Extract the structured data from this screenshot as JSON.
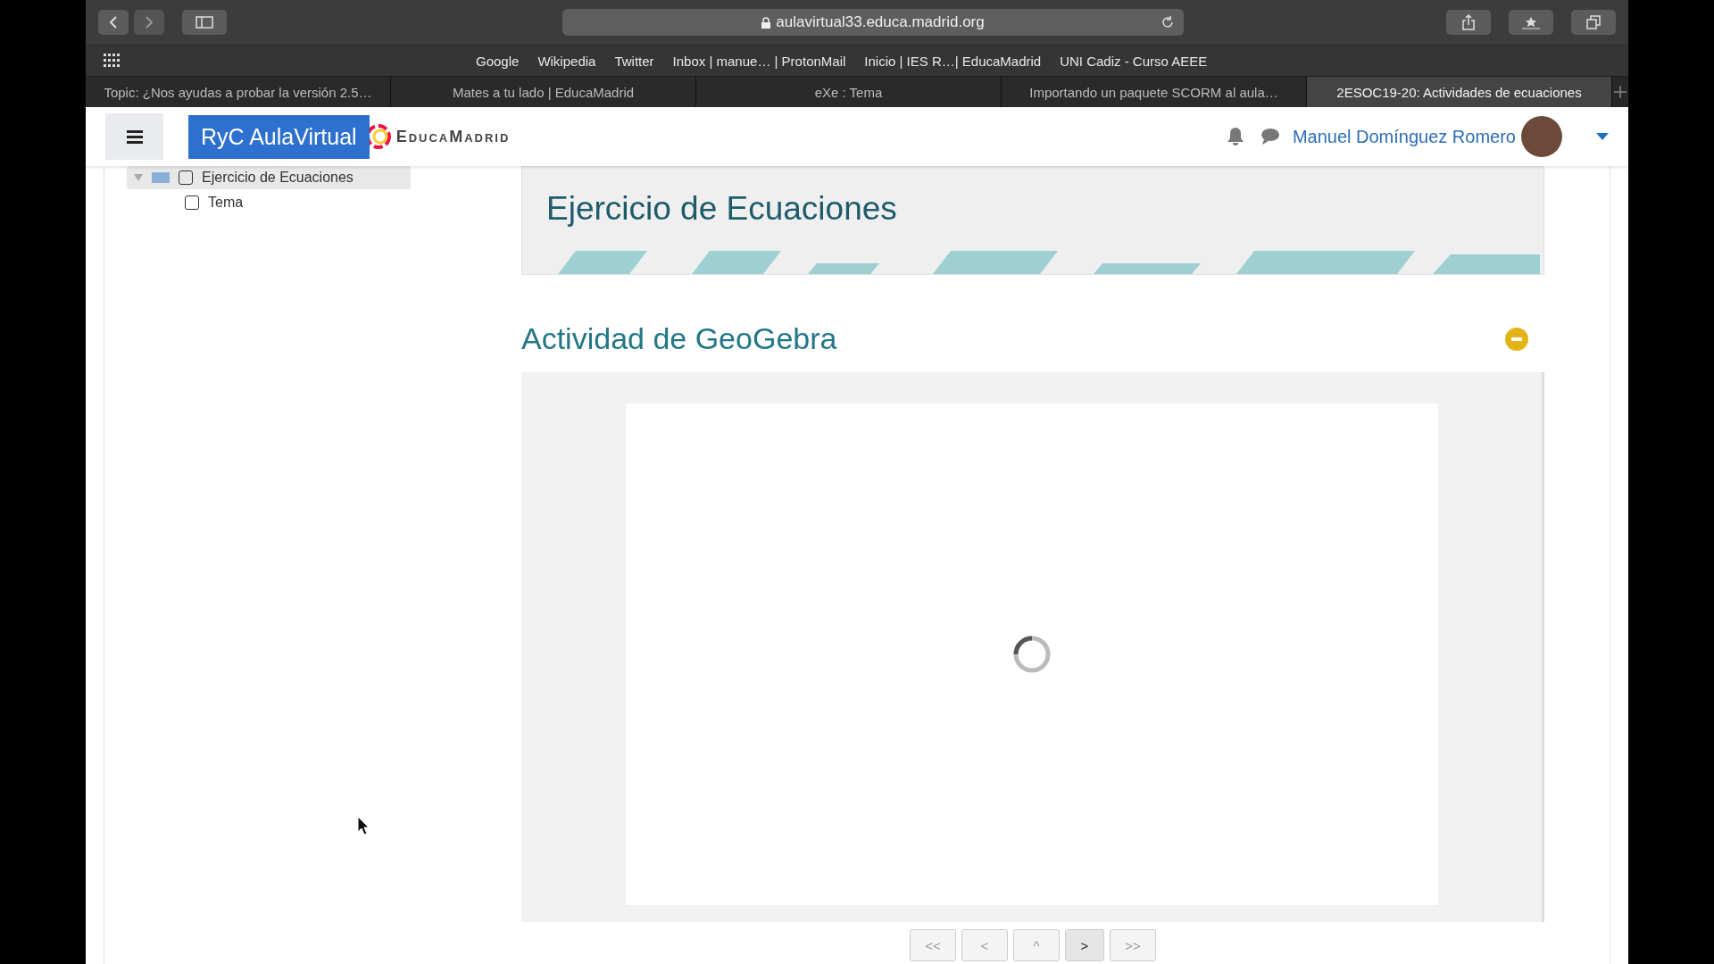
{
  "browser": {
    "url": "aulavirtual33.educa.madrid.org",
    "bookmarks": [
      "Google",
      "Wikipedia",
      "Twitter",
      "Inbox | manue… | ProtonMail",
      "Inicio | IES R…| EducaMadrid",
      "UNI Cadiz - Curso AEEE"
    ],
    "tabs": [
      {
        "title": "Topic: ¿Nos ayudas a probar la versión 2.5…",
        "selected": false
      },
      {
        "title": "Mates a tu lado | EducaMadrid",
        "selected": false
      },
      {
        "title": "eXe : Tema",
        "selected": false
      },
      {
        "title": "Importando un paquete SCORM al aula…",
        "selected": false
      },
      {
        "title": "2ESOC19-20: Actividades de ecuaciones",
        "selected": true
      }
    ]
  },
  "header": {
    "site_button": "RyC AulaVirtual",
    "logo_text": "EducaMadrid",
    "user_name": "Manuel Domínguez Romero"
  },
  "sidebar": {
    "tree": [
      {
        "label": "Ejercicio de Ecuaciones",
        "selected": true,
        "expanded": true,
        "children": [
          {
            "label": "Tema",
            "selected": false
          }
        ]
      }
    ]
  },
  "page_title": "Ejercicio de Ecuaciones",
  "section_title": "Actividad de GeoGebra",
  "nav_buttons": [
    {
      "label": "<<",
      "selected": false
    },
    {
      "label": "<",
      "selected": false
    },
    {
      "label": "^",
      "selected": false
    },
    {
      "label": ">",
      "selected": true
    },
    {
      "label": ">>",
      "selected": false
    }
  ]
}
